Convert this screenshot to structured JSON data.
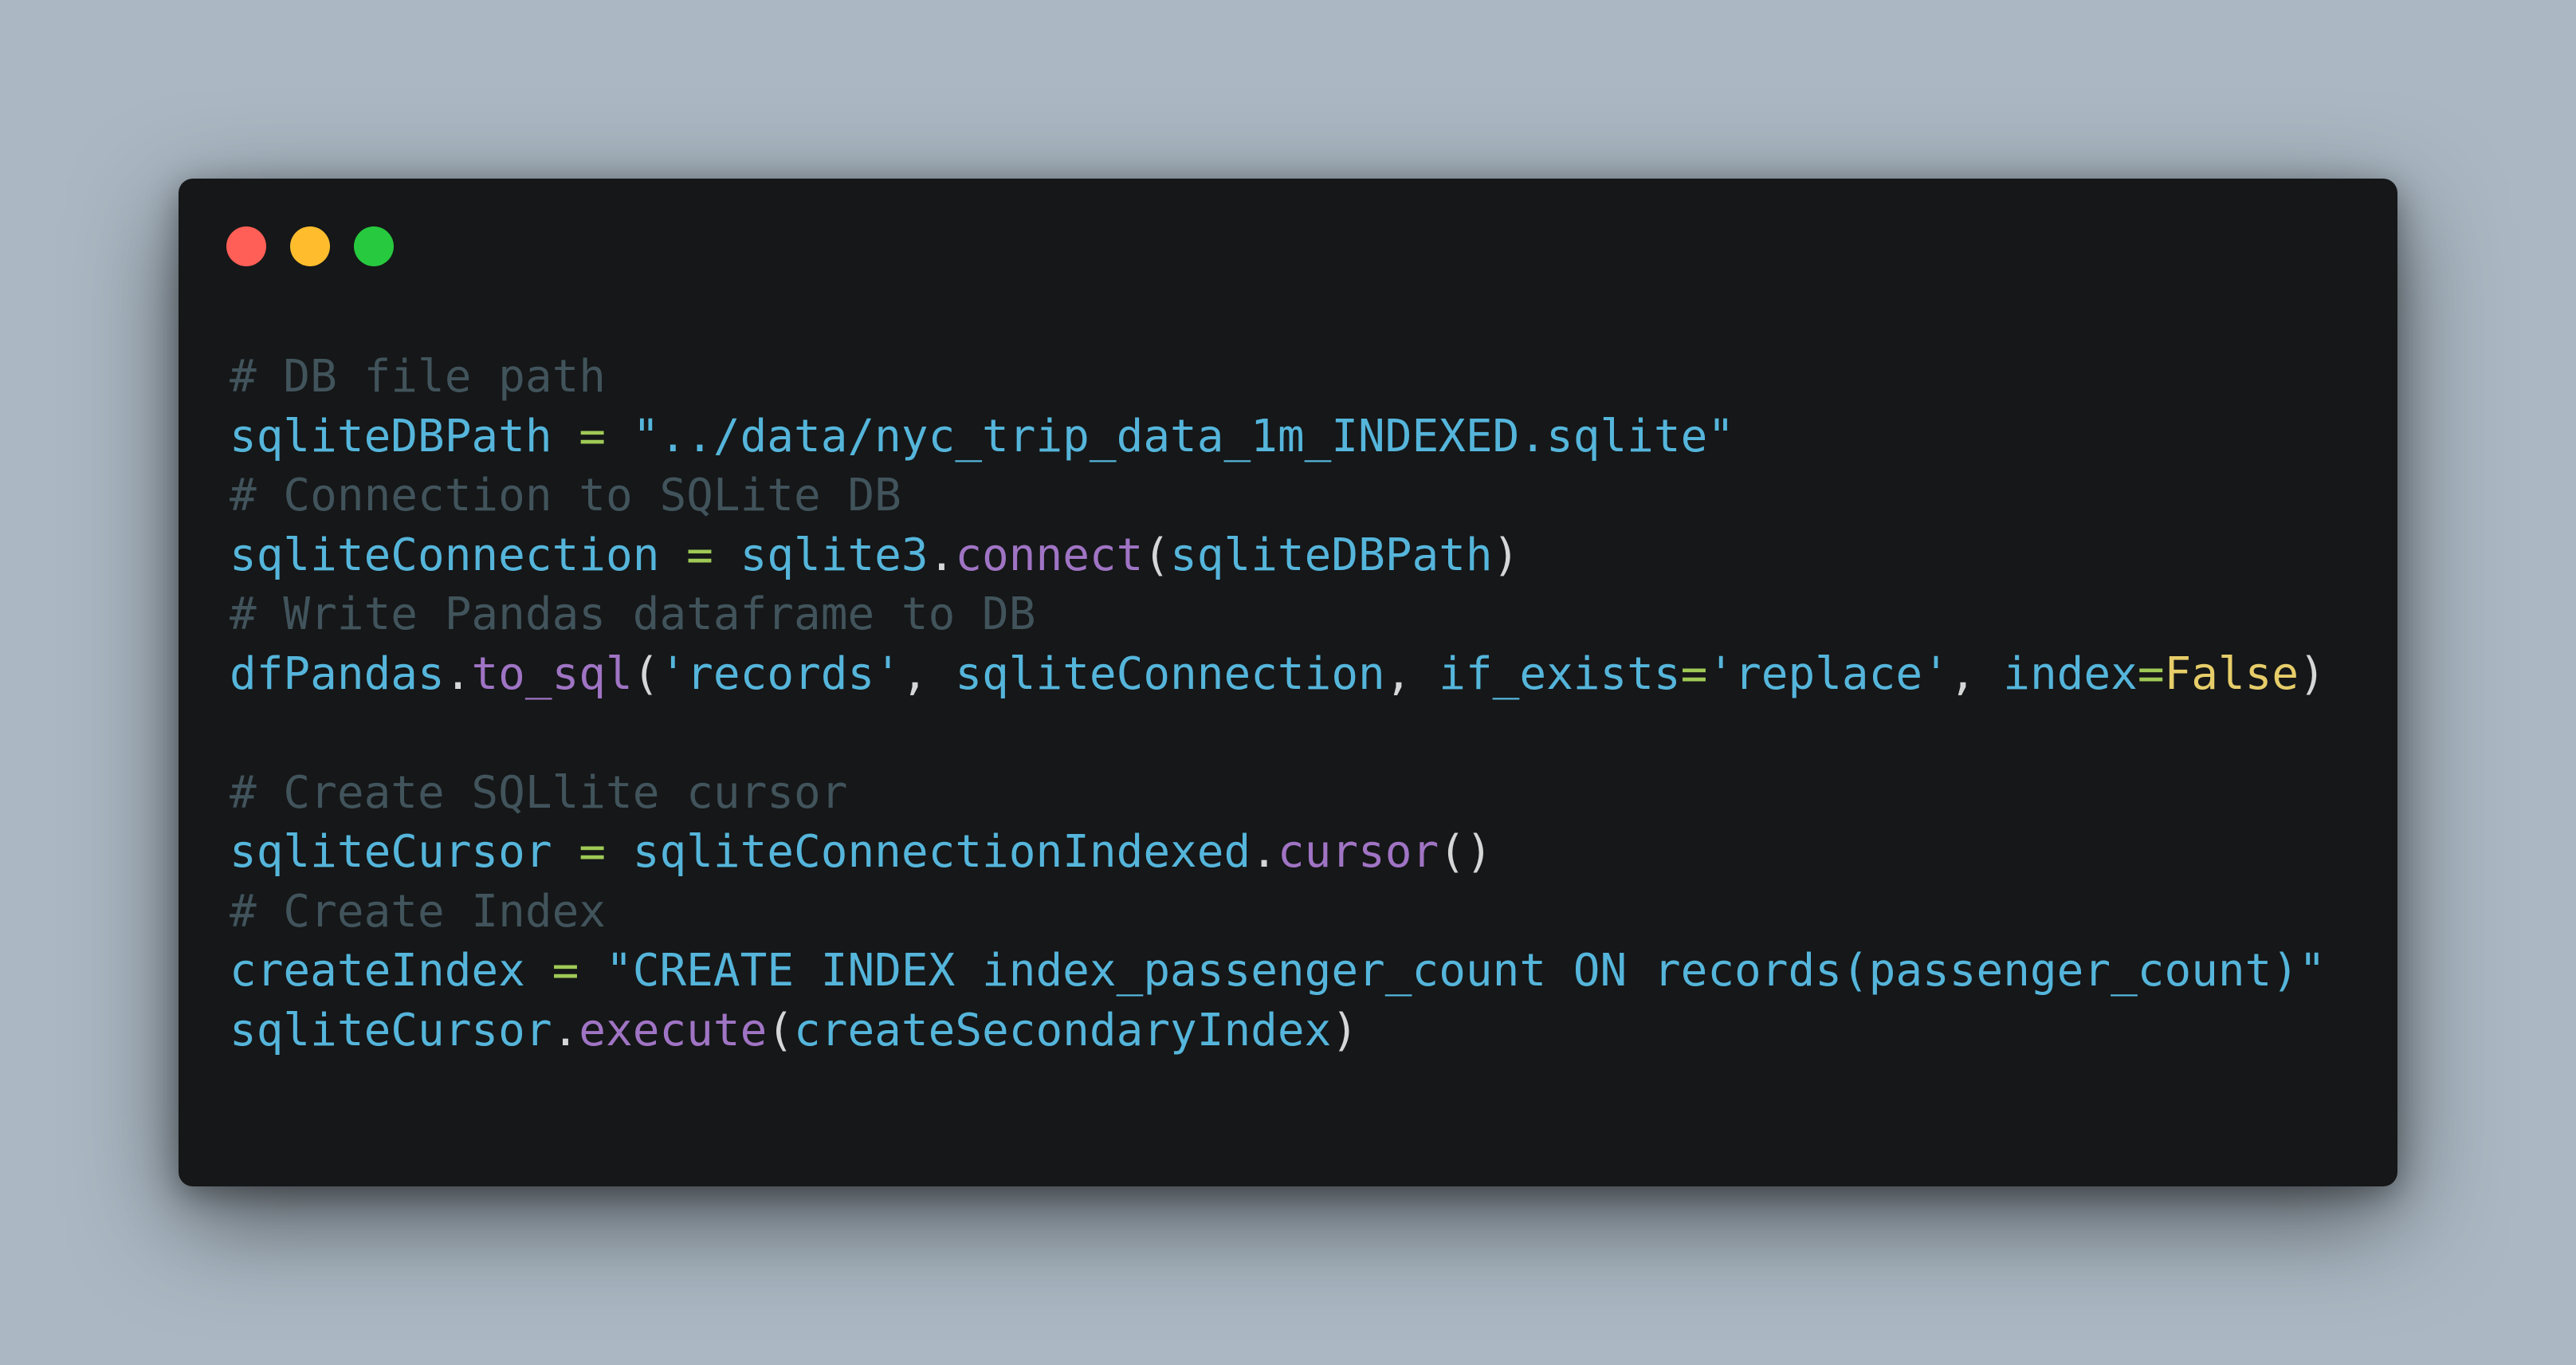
{
  "window": {
    "controls": [
      {
        "name": "close",
        "color": "#ff5f56"
      },
      {
        "name": "minimize",
        "color": "#ffbd2e"
      },
      {
        "name": "zoom",
        "color": "#27c93f"
      }
    ]
  },
  "theme": {
    "background": "#abb8c3",
    "editor_background": "#151718",
    "comment": "#41535b",
    "identifier": "#55b5db",
    "string": "#55b5db",
    "operator": "#9fca56",
    "function": "#a074c4",
    "punctuation": "#d4d7d6",
    "keyword": "#e6cd69"
  },
  "code": {
    "lines": [
      [
        {
          "t": "# DB file path",
          "c": "comment"
        }
      ],
      [
        {
          "t": "sqliteDBPath",
          "c": "var"
        },
        {
          "t": " = ",
          "c": "op"
        },
        {
          "t": "\"../data/nyc_trip_data_1m_INDEXED.sqlite\"",
          "c": "str"
        }
      ],
      [
        {
          "t": "# Connection to SQLite DB",
          "c": "comment"
        }
      ],
      [
        {
          "t": "sqliteConnection",
          "c": "var"
        },
        {
          "t": " = ",
          "c": "op"
        },
        {
          "t": "sqlite3",
          "c": "var"
        },
        {
          "t": ".",
          "c": "punc"
        },
        {
          "t": "connect",
          "c": "func"
        },
        {
          "t": "(",
          "c": "punc"
        },
        {
          "t": "sqliteDBPath",
          "c": "var"
        },
        {
          "t": ")",
          "c": "punc"
        }
      ],
      [
        {
          "t": "# Write Pandas dataframe to DB",
          "c": "comment"
        }
      ],
      [
        {
          "t": "dfPandas",
          "c": "var"
        },
        {
          "t": ".",
          "c": "punc"
        },
        {
          "t": "to_sql",
          "c": "func"
        },
        {
          "t": "(",
          "c": "punc"
        },
        {
          "t": "'records'",
          "c": "str"
        },
        {
          "t": ", ",
          "c": "punc"
        },
        {
          "t": "sqliteConnection",
          "c": "var"
        },
        {
          "t": ", ",
          "c": "punc"
        },
        {
          "t": "if_exists",
          "c": "var"
        },
        {
          "t": "=",
          "c": "op"
        },
        {
          "t": "'replace'",
          "c": "str"
        },
        {
          "t": ", ",
          "c": "punc"
        },
        {
          "t": "index",
          "c": "var"
        },
        {
          "t": "=",
          "c": "op"
        },
        {
          "t": "False",
          "c": "kw"
        },
        {
          "t": ")",
          "c": "punc"
        }
      ],
      [],
      [
        {
          "t": "# Create SQLlite cursor",
          "c": "comment"
        }
      ],
      [
        {
          "t": "sqliteCursor",
          "c": "var"
        },
        {
          "t": " = ",
          "c": "op"
        },
        {
          "t": "sqliteConnectionIndexed",
          "c": "var"
        },
        {
          "t": ".",
          "c": "punc"
        },
        {
          "t": "cursor",
          "c": "func"
        },
        {
          "t": "()",
          "c": "punc"
        }
      ],
      [
        {
          "t": "# Create Index",
          "c": "comment"
        }
      ],
      [
        {
          "t": "createIndex",
          "c": "var"
        },
        {
          "t": " = ",
          "c": "op"
        },
        {
          "t": "\"CREATE INDEX index_passenger_count ON records(passenger_count)\"",
          "c": "str"
        }
      ],
      [
        {
          "t": "sqliteCursor",
          "c": "var"
        },
        {
          "t": ".",
          "c": "punc"
        },
        {
          "t": "execute",
          "c": "func"
        },
        {
          "t": "(",
          "c": "punc"
        },
        {
          "t": "createSecondaryIndex",
          "c": "var"
        },
        {
          "t": ")",
          "c": "punc"
        }
      ]
    ]
  }
}
